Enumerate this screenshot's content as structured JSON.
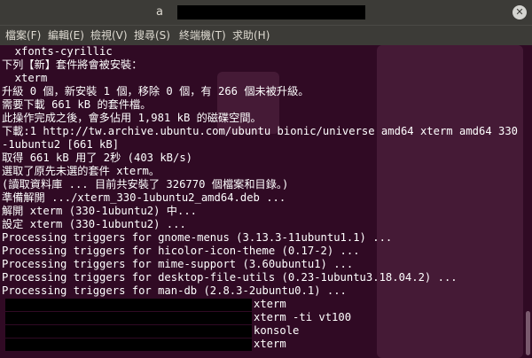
{
  "window": {
    "title_visible": "a"
  },
  "menubar": {
    "items": [
      "檔案(F)",
      "編輯(E)",
      "檢視(V)",
      "搜尋(S)",
      "終端機(T)",
      "求助(H)"
    ]
  },
  "terminal": {
    "lines": [
      "  xfonts-cyrillic",
      "下列【新】套件將會被安裝：",
      "  xterm",
      "升級 0 個，新安裝 1 個，移除 0 個，有 266 個未被升級。",
      "需要下載 661 kB 的套件檔。",
      "此操作完成之後，會多佔用 1,981 kB 的磁碟空間。",
      "下載:1 http://tw.archive.ubuntu.com/ubuntu bionic/universe amd64 xterm amd64 330",
      "-1ubuntu2 [661 kB]",
      "取得 661 kB 用了 2秒 (403 kB/s)",
      "選取了原先未選的套件 xterm。",
      "(讀取資料庫 ... 目前共安裝了 326770 個檔案和目錄。)",
      "準備解開 .../xterm_330-1ubuntu2_amd64.deb ...",
      "解開 xterm (330-1ubuntu2) 中...",
      "設定 xterm (330-1ubuntu2) ...",
      "Processing triggers for gnome-menus (3.13.3-11ubuntu1.1) ...",
      "Processing triggers for hicolor-icon-theme (0.17-2) ...",
      "Processing triggers for mime-support (3.60ubuntu1) ...",
      "Processing triggers for desktop-file-utils (0.23-1ubuntu3.18.04.2) ...",
      "Processing triggers for man-db (2.8.3-2ubuntu0.1) ..."
    ],
    "alternatives": [
      "xterm",
      "xterm -ti vt100",
      "konsole",
      "xterm"
    ]
  },
  "colors": {
    "terminal_bg": "#300a24",
    "chrome_bg": "#3c3b37",
    "text": "#ffffff"
  }
}
